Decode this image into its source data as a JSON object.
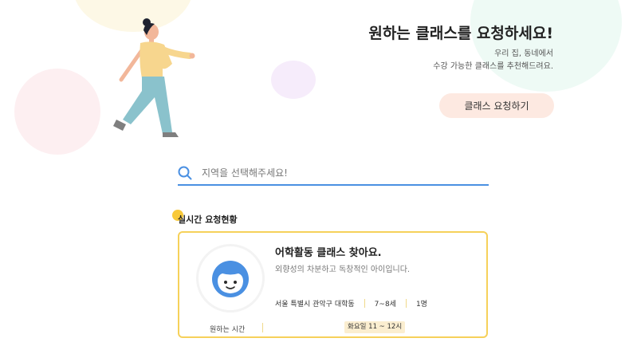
{
  "hero": {
    "title": "원하는 클래스를 요청하세요!",
    "subtitle_line1": "우리 집, 동네에서",
    "subtitle_line2": "수강 가능한 클래스를 추천해드려요.",
    "request_button": "클래스 요청하기"
  },
  "search": {
    "placeholder": "지역을 선택해주세요!"
  },
  "live_requests": {
    "section_title": "실시간 요청현황",
    "card": {
      "title": "어학활동 클래스 찾아요.",
      "description": "외향성의 차분하고 독창적인 아이입니다.",
      "location": "서울 특별시 관악구 대학동",
      "age": "7~8세",
      "count": "1명",
      "time_label": "원하는 시간",
      "time_value": "화요일 11 ~ 12시"
    }
  },
  "colors": {
    "accent_blue": "#4a90e2",
    "card_border": "#f6d15a",
    "button_bg": "#fde9e1"
  }
}
